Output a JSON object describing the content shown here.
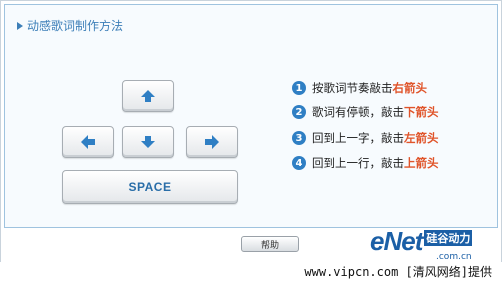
{
  "panel": {
    "title": "动感歌词制作方法"
  },
  "keys": {
    "up_icon": "arrow-up-icon",
    "left_icon": "arrow-left-icon",
    "down_icon": "arrow-down-icon",
    "right_icon": "arrow-right-icon",
    "space_label": "SPACE"
  },
  "instructions": [
    {
      "num": "1",
      "text": "按歌词节奏敲击",
      "highlight": "右箭头"
    },
    {
      "num": "2",
      "text": "歌词有停顿，敲击",
      "highlight": "下箭头"
    },
    {
      "num": "3",
      "text": "回到上一字，敲击",
      "highlight": "左箭头"
    },
    {
      "num": "4",
      "text": "回到上一行，敲击",
      "highlight": "上箭头"
    }
  ],
  "buttons": {
    "help_label": "帮助"
  },
  "watermark": {
    "logo_text": "eNet",
    "logo_cn": "硅谷动力",
    "logo_domain": ".com.cn"
  },
  "footer": {
    "text": "www.vipcn.com [清风网络]提供"
  },
  "colors": {
    "accent_blue": "#2f7fc4",
    "highlight_orange": "#e0542a",
    "panel_border": "#9fc3df"
  }
}
